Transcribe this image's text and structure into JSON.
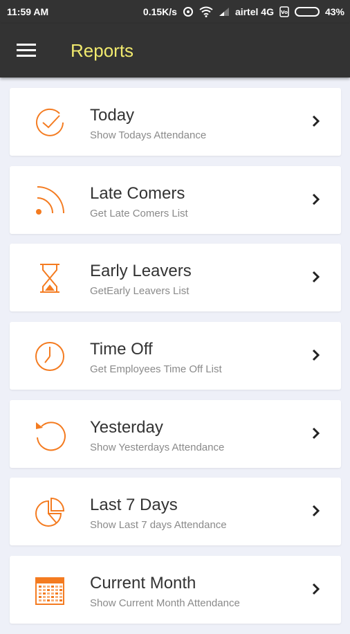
{
  "status_bar": {
    "time": "11:59 AM",
    "speed": "0.15K/s",
    "carrier": "airtel 4G",
    "battery": "43%",
    "battery_level": 0.43
  },
  "app_bar": {
    "title": "Reports",
    "menu_icon": "hamburger-menu-icon"
  },
  "colors": {
    "accent": "#f47b20",
    "title": "#f1ea6e",
    "bar": "#333333"
  },
  "reports": [
    {
      "title": "Today",
      "subtitle": "Show Todays Attendance",
      "icon": "check-circle-icon"
    },
    {
      "title": "Late Comers",
      "subtitle": "Get Late Comers List",
      "icon": "signal-waves-icon"
    },
    {
      "title": "Early Leavers",
      "subtitle": "GetEarly Leavers List",
      "icon": "hourglass-icon"
    },
    {
      "title": "Time Off",
      "subtitle": "Get Employees Time Off List",
      "icon": "clock-icon"
    },
    {
      "title": "Yesterday",
      "subtitle": "Show Yesterdays Attendance",
      "icon": "undo-circle-icon"
    },
    {
      "title": "Last 7 Days",
      "subtitle": "Show Last 7 days Attendance",
      "icon": "pie-chart-icon"
    },
    {
      "title": "Current Month",
      "subtitle": "Show Current Month Attendance",
      "icon": "calendar-icon"
    }
  ]
}
